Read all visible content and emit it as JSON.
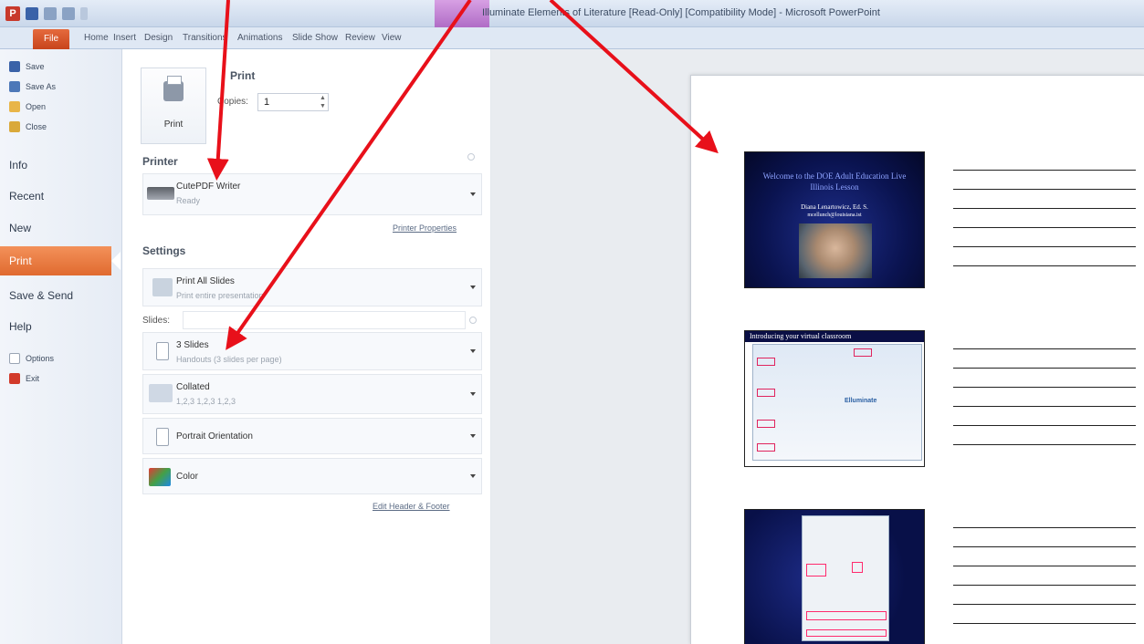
{
  "window": {
    "title": "Illuminate Elements of Literature [Read-Only] [Compatibility Mode] - Microsoft PowerPoint"
  },
  "ribbon": {
    "file_tab": "File",
    "tabs": [
      "Home",
      "Insert",
      "Design",
      "Transitions",
      "Animations",
      "Slide Show",
      "Review",
      "View"
    ]
  },
  "nav": {
    "save": "Save",
    "save_as": "Save As",
    "open": "Open",
    "close": "Close",
    "info": "Info",
    "recent": "Recent",
    "new": "New",
    "print": "Print",
    "save_send": "Save & Send",
    "help": "Help",
    "options": "Options",
    "exit": "Exit"
  },
  "print": {
    "heading": "Print",
    "button_label": "Print",
    "copies_label": "Copies:",
    "copies_value": "1"
  },
  "printer": {
    "heading": "Printer",
    "name": "CutePDF Writer",
    "status": "Ready",
    "properties_link": "Printer Properties"
  },
  "settings": {
    "heading": "Settings",
    "range_main": "Print All Slides",
    "range_sub": "Print entire presentation",
    "slides_label": "Slides:",
    "layout_main": "3 Slides",
    "layout_sub": "Handouts (3 slides per page)",
    "collate_main": "Collated",
    "collate_sub": "1,2,3   1,2,3   1,2,3",
    "orientation": "Portrait Orientation",
    "color": "Color",
    "header_footer_link": "Edit Header & Footer"
  },
  "preview": {
    "slide1_title": "Welcome to the DOE Adult Education Live Illinois Lesson",
    "slide1_name": "Diana Lenartowicz, Ed. S.",
    "slide1_email": "mcellunch@louisiana.ist",
    "slide2_title": "Introducing      your virtual classroom",
    "slide2_logo": "Elluminate"
  },
  "colors": {
    "file_tab": "#c8441b",
    "print_selected": "#e06a2f",
    "annotation_arrow": "#e8101a"
  }
}
